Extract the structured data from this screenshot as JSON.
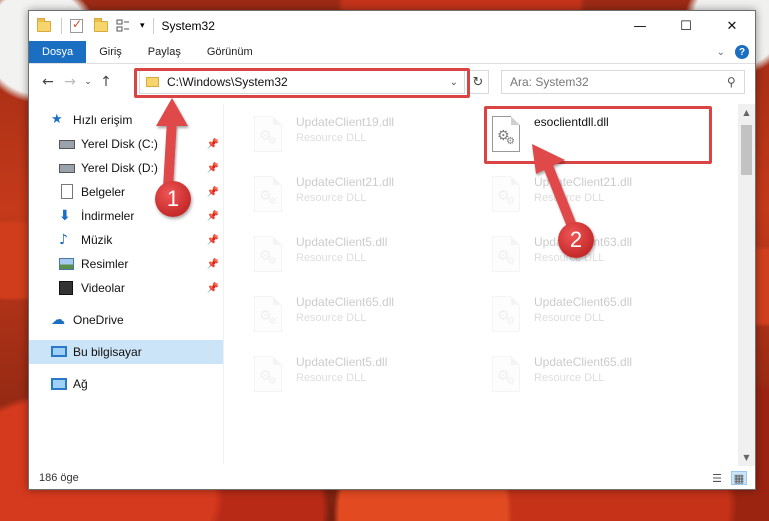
{
  "window": {
    "title": "System32",
    "qa_dropdown": "▾",
    "controls": {
      "minimize": "—",
      "maximize": "☐",
      "close": "✕"
    }
  },
  "ribbon": {
    "tabs": [
      {
        "label": "Dosya"
      },
      {
        "label": "Giriş"
      },
      {
        "label": "Paylaş"
      },
      {
        "label": "Görünüm"
      }
    ],
    "collapse": "⌄",
    "help": "?"
  },
  "nav": {
    "back": "←",
    "forward": "→",
    "recent": "⌄",
    "up": "↑",
    "address": "C:\\Windows\\System32",
    "address_dropdown": "⌄",
    "refresh": "↻",
    "search_placeholder": "Ara: System32",
    "search_icon": "⚲"
  },
  "sidebar": {
    "items": [
      {
        "label": "Hızlı erişim",
        "icon": "star-icon",
        "pinned": false
      },
      {
        "label": "Yerel Disk (C:)",
        "icon": "drive-icon",
        "pinned": true
      },
      {
        "label": "Yerel Disk (D:)",
        "icon": "drive-icon",
        "pinned": true
      },
      {
        "label": "Belgeler",
        "icon": "documents-icon",
        "pinned": true
      },
      {
        "label": "İndirmeler",
        "icon": "downloads-icon",
        "pinned": true
      },
      {
        "label": "Müzik",
        "icon": "music-icon",
        "pinned": true
      },
      {
        "label": "Resimler",
        "icon": "pictures-icon",
        "pinned": true
      },
      {
        "label": "Videolar",
        "icon": "videos-icon",
        "pinned": true
      },
      {
        "label": "OneDrive",
        "icon": "onedrive-icon",
        "pinned": false
      },
      {
        "label": "Bu bilgisayar",
        "icon": "this-pc-icon",
        "pinned": false,
        "selected": true
      },
      {
        "label": "Ağ",
        "icon": "network-icon",
        "pinned": false
      }
    ],
    "pin_glyph": "📌"
  },
  "files": {
    "left": [
      {
        "name": "UpdateClient19.dll",
        "type": "Resource DLL"
      },
      {
        "name": "UpdateClient21.dll",
        "type": "Resource DLL"
      },
      {
        "name": "UpdateClient5.dll",
        "type": "Resource DLL"
      },
      {
        "name": "UpdateClient65.dll",
        "type": "Resource DLL"
      },
      {
        "name": "UpdateClient5.dll",
        "type": "Resource DLL"
      }
    ],
    "right": [
      {
        "name": "esoclientdll.dll",
        "type": "",
        "highlight": true
      },
      {
        "name": "UpdateClient21.dll",
        "type": "Resource DLL"
      },
      {
        "name": "UpdateClient63.dll",
        "type": "Resource DLL"
      },
      {
        "name": "UpdateClient65.dll",
        "type": "Resource DLL"
      },
      {
        "name": "UpdateClient65.dll",
        "type": "Resource DLL"
      }
    ]
  },
  "status": {
    "count": "186 öge"
  },
  "annotations": {
    "step1": "1",
    "step2": "2",
    "accent": "#d94545"
  },
  "colors": {
    "ribbon_active": "#1a6fc2",
    "selection": "#cce4f7"
  }
}
